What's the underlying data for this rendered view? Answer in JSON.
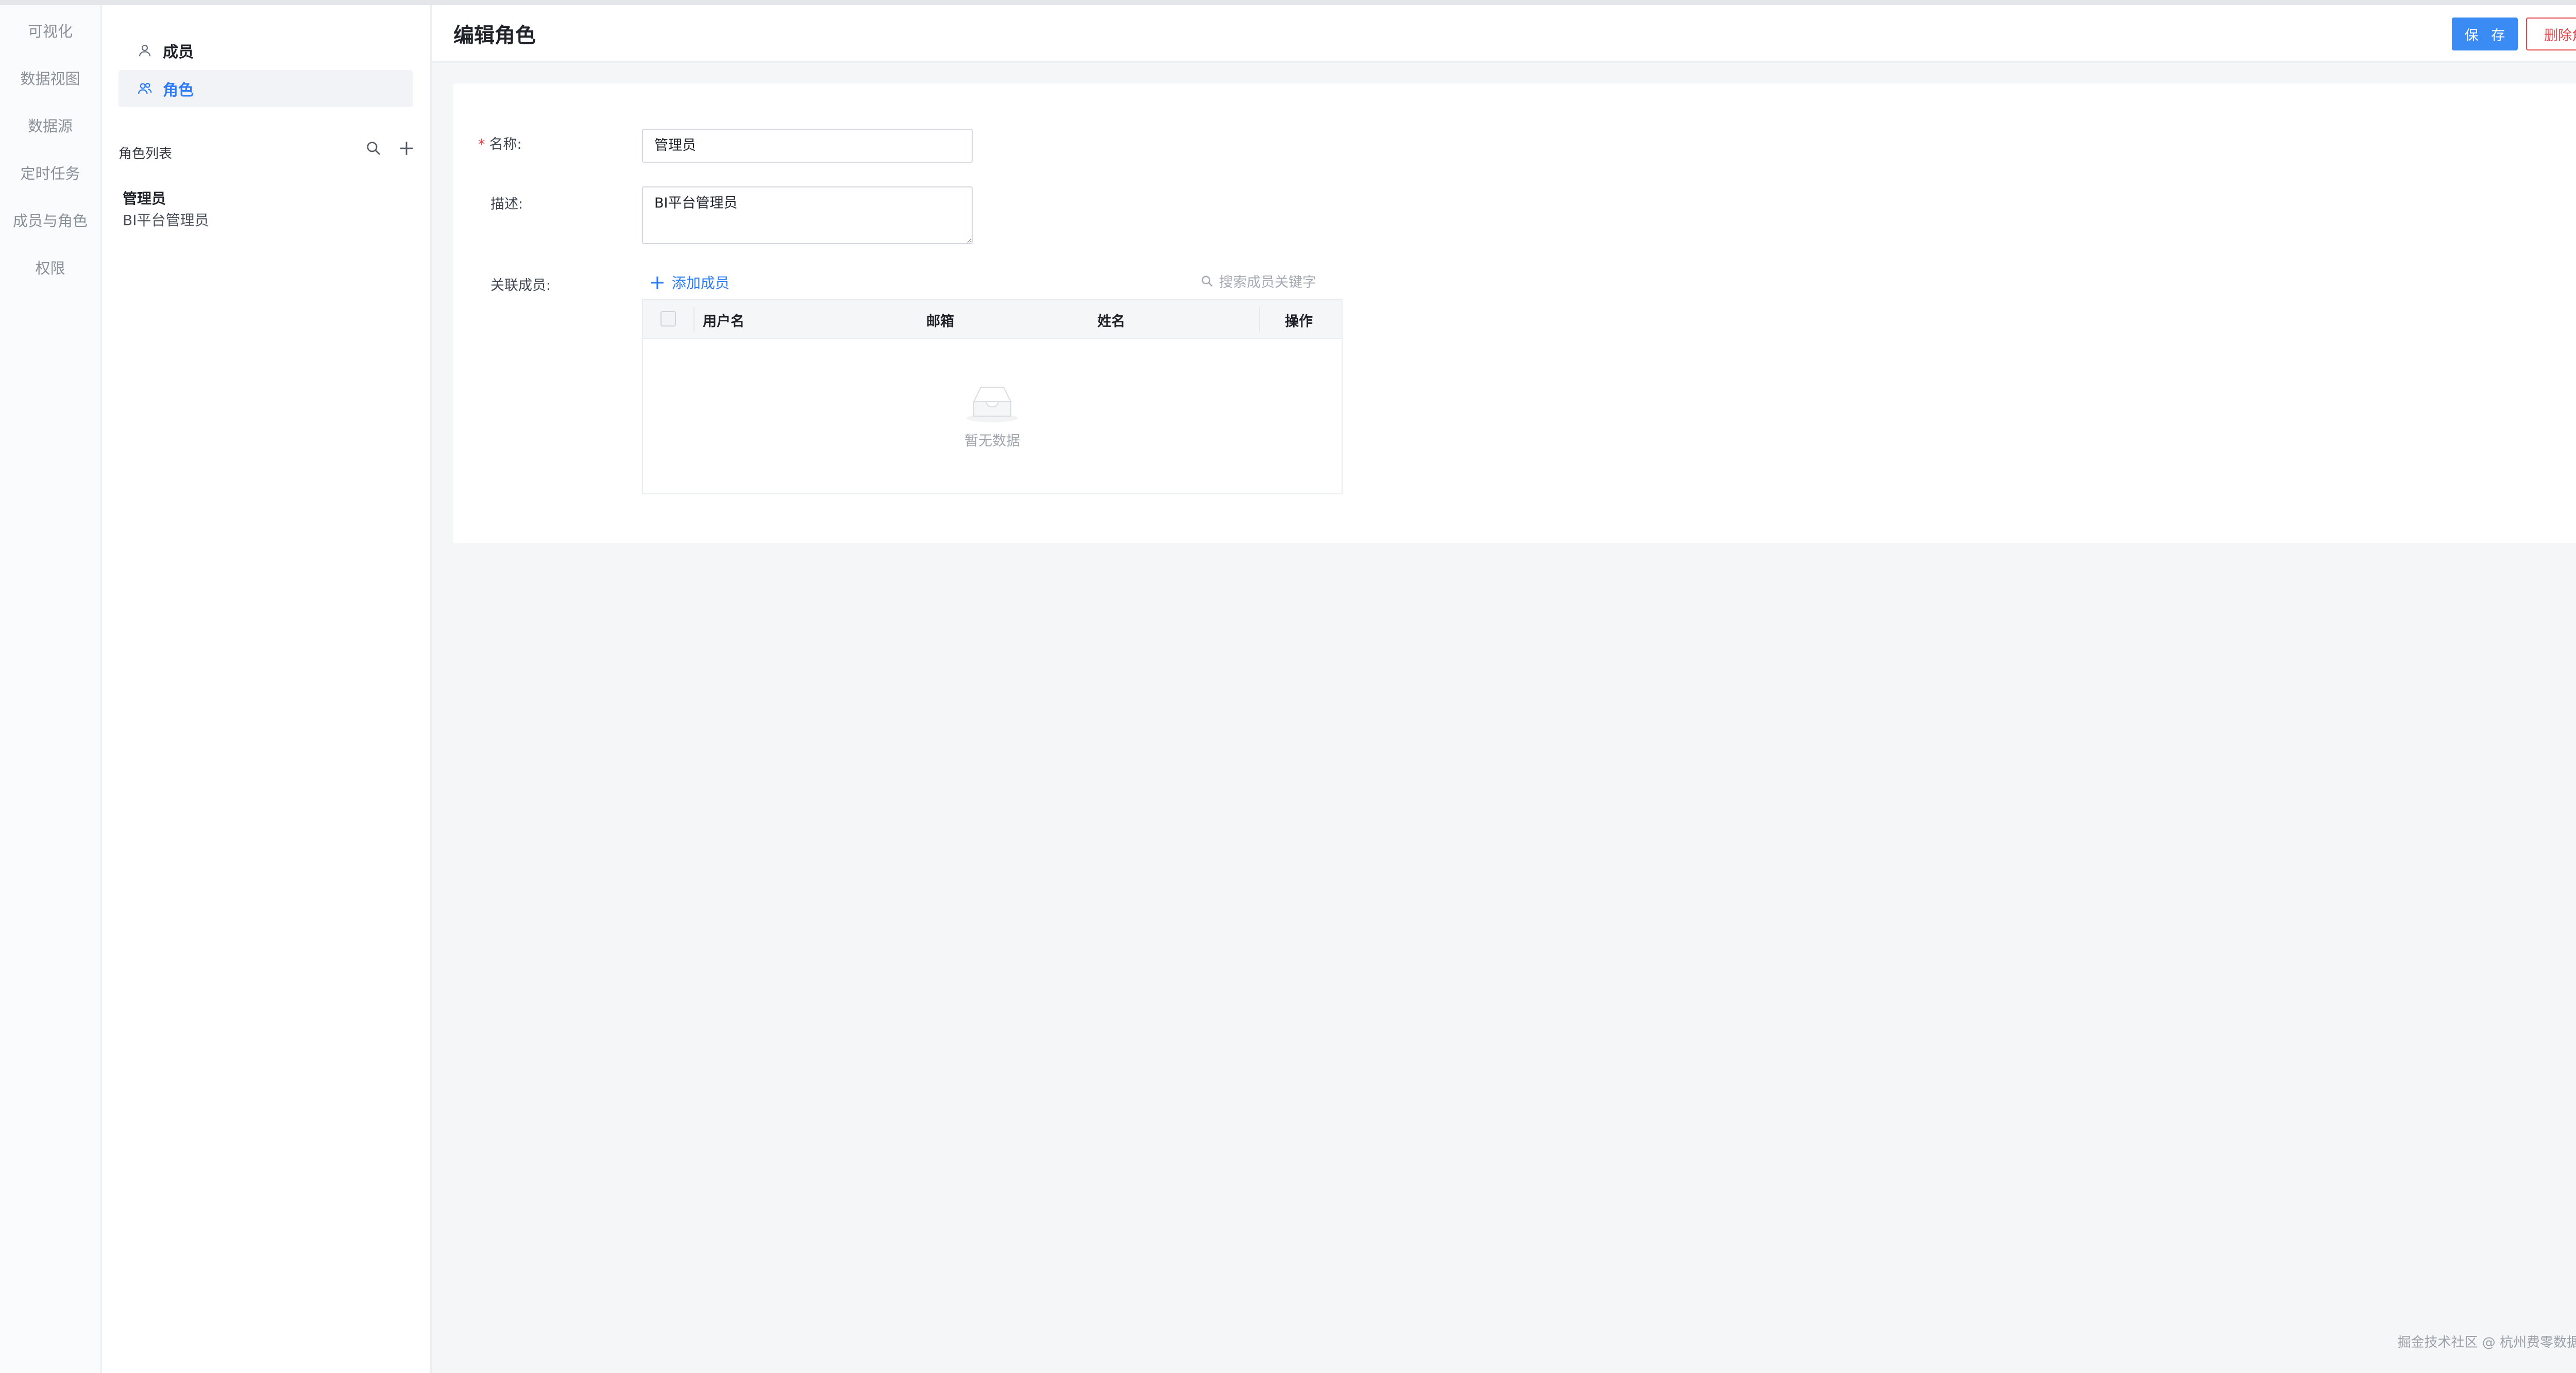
{
  "nav": {
    "items": [
      "可视化",
      "数据视图",
      "数据源",
      "定时任务",
      "成员与角色",
      "权限"
    ]
  },
  "panel": {
    "menu": [
      {
        "label": "成员",
        "icon": "user-icon"
      },
      {
        "label": "角色",
        "icon": "users-icon"
      }
    ],
    "list_title": "角色列表",
    "roles": [
      {
        "name": "管理员",
        "description": "BI平台管理员"
      }
    ]
  },
  "header": {
    "title": "编辑角色",
    "save_label": "保 存",
    "delete_label": "删除角色"
  },
  "form": {
    "name_label": "名称:",
    "name_value": "管理员",
    "desc_label": "描述:",
    "desc_value": "BI平台管理员",
    "members_label": "关联成员:",
    "add_member_label": "添加成员",
    "search_placeholder": "搜索成员关键字",
    "table_headers": [
      "用户名",
      "邮箱",
      "姓名",
      "操作"
    ],
    "empty_text": "暂无数据"
  },
  "footer": {
    "watermark": "掘金技术社区 @ 杭州费零数据科技"
  },
  "colors": {
    "primary": "#3b8bf5",
    "danger": "#e5484d",
    "active_text": "#2e7cf6"
  }
}
